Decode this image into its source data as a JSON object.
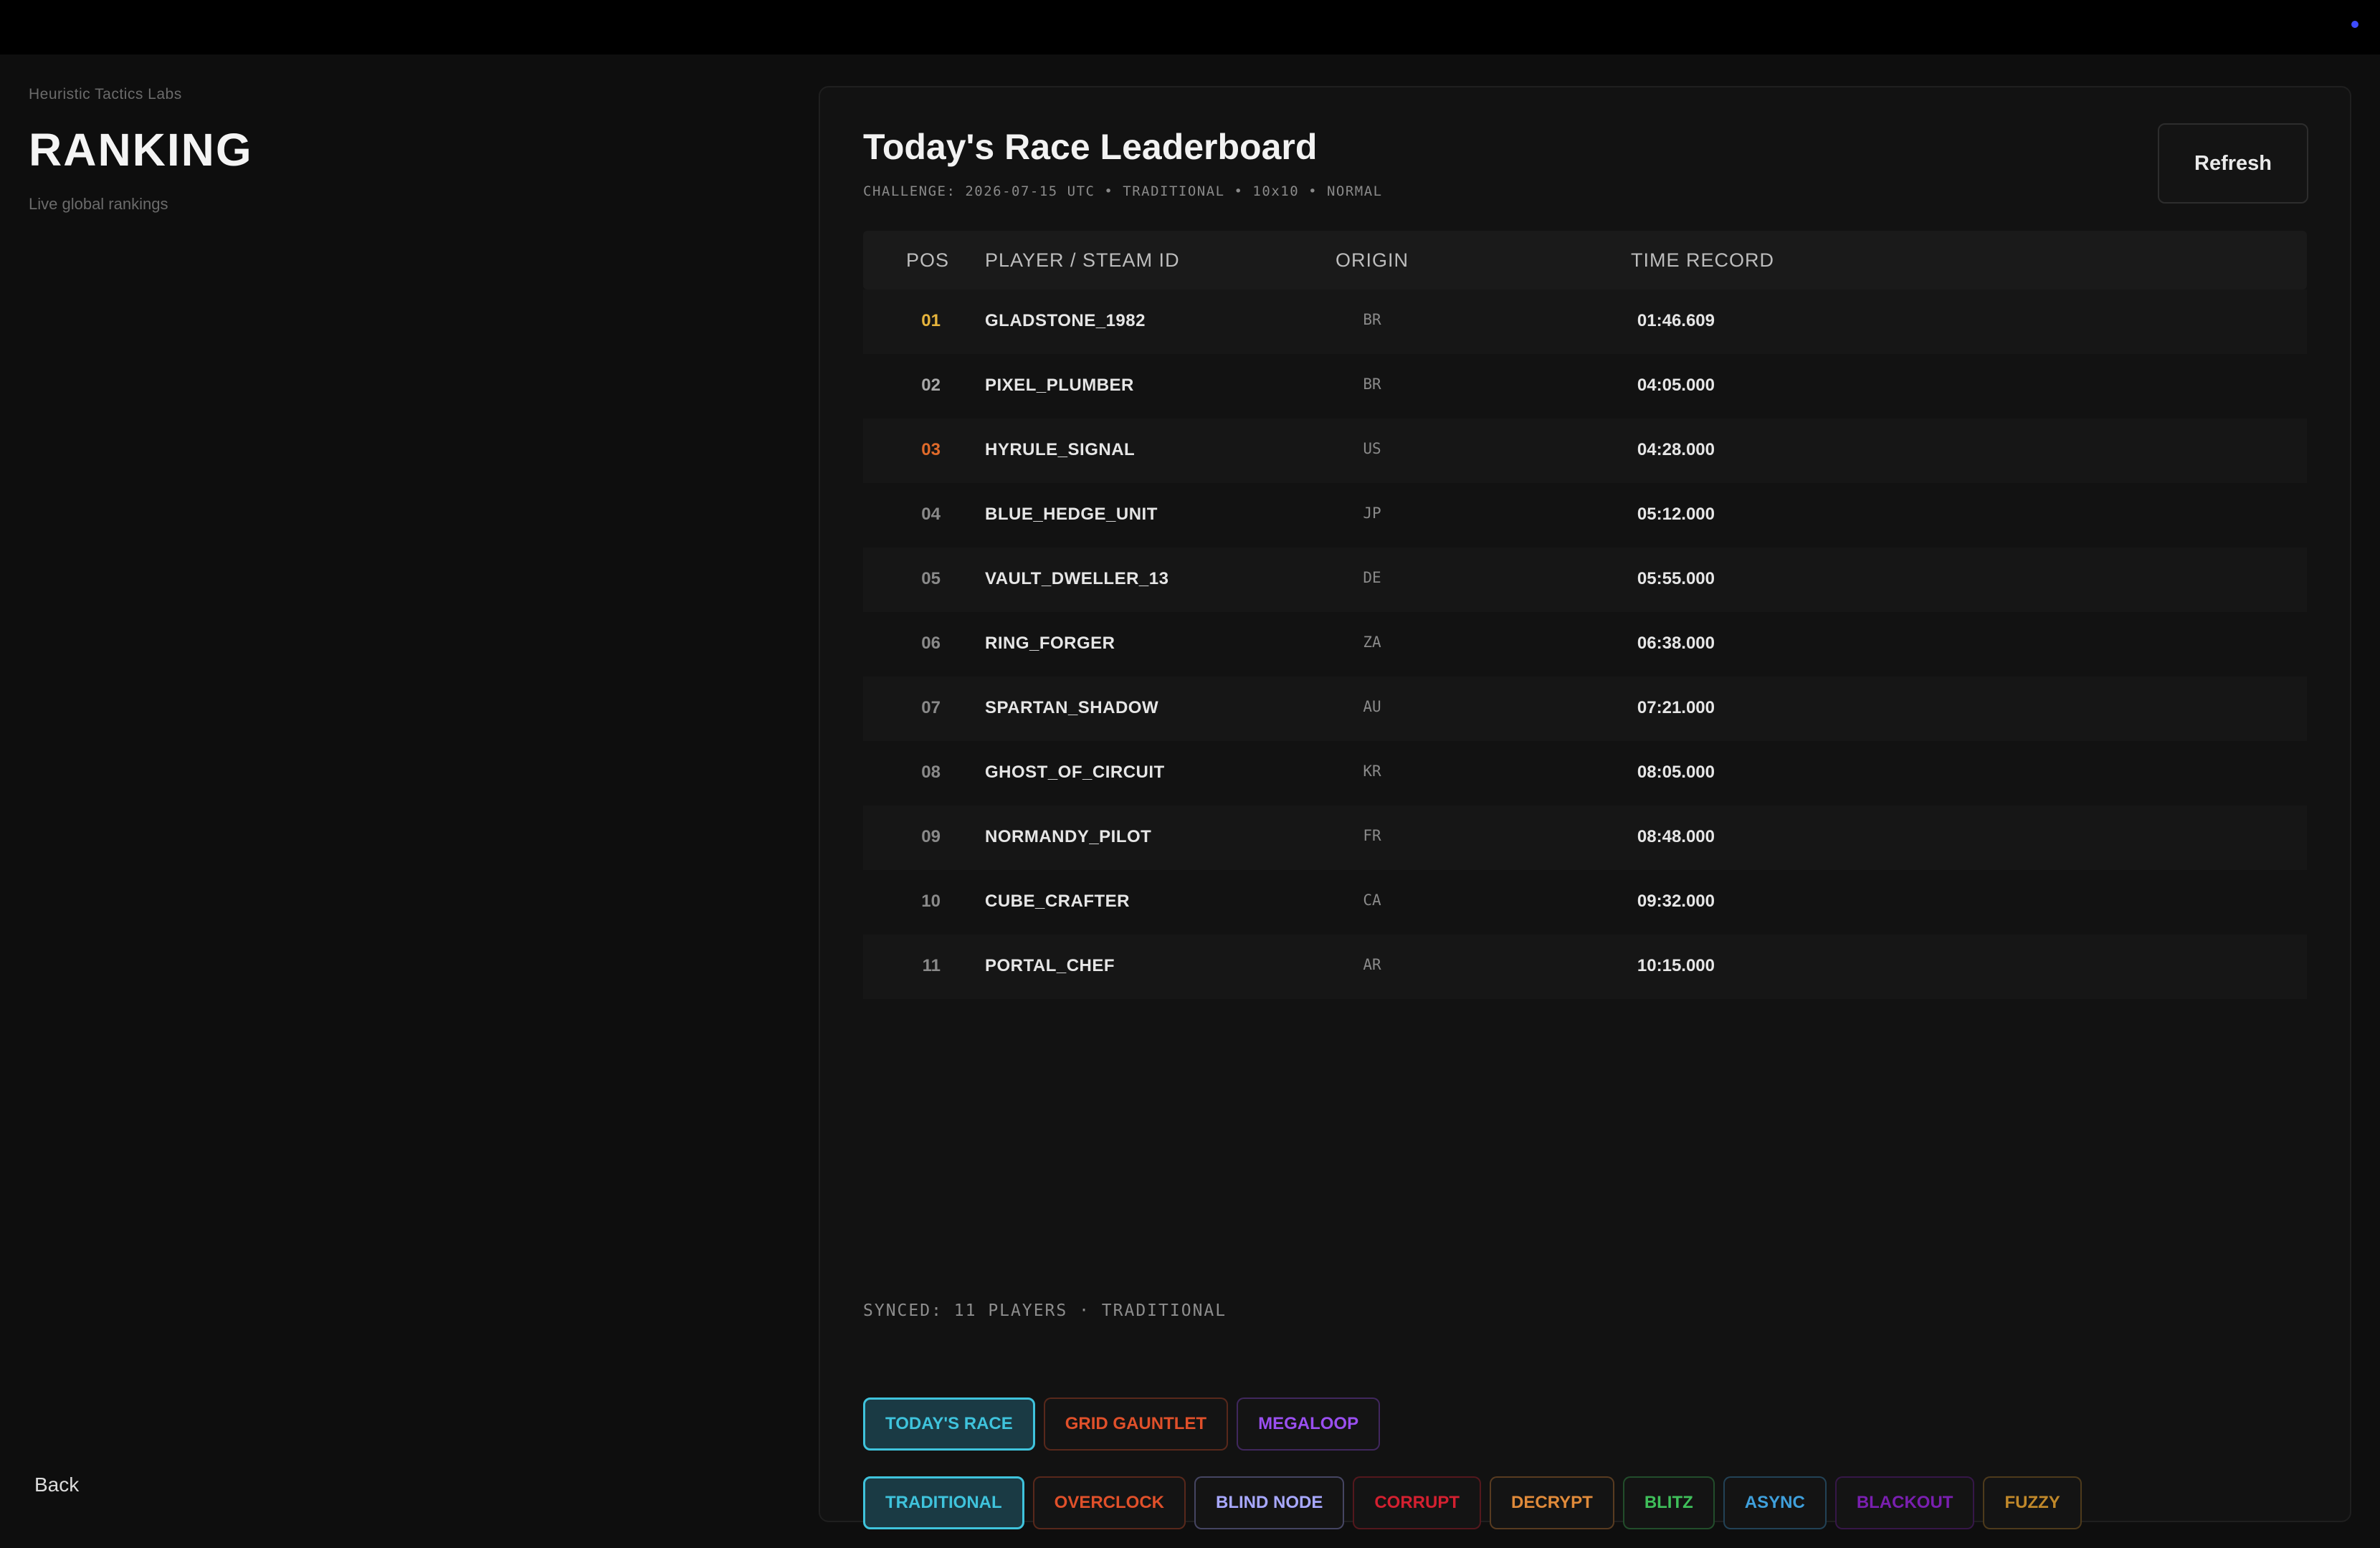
{
  "header": {
    "org": "Heuristic Tactics Labs",
    "title": "RANKING",
    "subtitle": "Live global rankings",
    "back_label": "Back"
  },
  "panel": {
    "title": "Today's Race Leaderboard",
    "meta": "CHALLENGE: 2026-07-15 UTC • TRADITIONAL • 10x10 • NORMAL",
    "refresh_label": "Refresh"
  },
  "table": {
    "columns": [
      "POS",
      "PLAYER / STEAM ID",
      "ORIGIN",
      "TIME RECORD"
    ],
    "rows": [
      {
        "pos": "01",
        "player": "GLADSTONE_1982",
        "origin": "BR",
        "time": "01:46.609",
        "pos_color": "#e6b43c"
      },
      {
        "pos": "02",
        "player": "PIXEL_PLUMBER",
        "origin": "BR",
        "time": "04:05.000",
        "pos_color": "#a8a8a8"
      },
      {
        "pos": "03",
        "player": "HYRULE_SIGNAL",
        "origin": "US",
        "time": "04:28.000",
        "pos_color": "#e06a2a"
      },
      {
        "pos": "04",
        "player": "BLUE_HEDGE_UNIT",
        "origin": "JP",
        "time": "05:12.000",
        "pos_color": "#8a8a8a"
      },
      {
        "pos": "05",
        "player": "VAULT_DWELLER_13",
        "origin": "DE",
        "time": "05:55.000",
        "pos_color": "#8a8a8a"
      },
      {
        "pos": "06",
        "player": "RING_FORGER",
        "origin": "ZA",
        "time": "06:38.000",
        "pos_color": "#8a8a8a"
      },
      {
        "pos": "07",
        "player": "SPARTAN_SHADOW",
        "origin": "AU",
        "time": "07:21.000",
        "pos_color": "#8a8a8a"
      },
      {
        "pos": "08",
        "player": "GHOST_OF_CIRCUIT",
        "origin": "KR",
        "time": "08:05.000",
        "pos_color": "#8a8a8a"
      },
      {
        "pos": "09",
        "player": "NORMANDY_PILOT",
        "origin": "FR",
        "time": "08:48.000",
        "pos_color": "#8a8a8a"
      },
      {
        "pos": "10",
        "player": "CUBE_CRAFTER",
        "origin": "CA",
        "time": "09:32.000",
        "pos_color": "#8a8a8a"
      },
      {
        "pos": "11",
        "player": "PORTAL_CHEF",
        "origin": "AR",
        "time": "10:15.000",
        "pos_color": "#8a8a8a"
      }
    ]
  },
  "status": "SYNCED: 11 PLAYERS · TRADITIONAL",
  "mode_tabs": [
    {
      "label": "TODAY'S RACE",
      "color": "#3fc3dc",
      "active": true
    },
    {
      "label": "GRID GAUNTLET",
      "color": "#e0502a",
      "active": false
    },
    {
      "label": "MEGALOOP",
      "color": "#9a4ff0",
      "active": false
    }
  ],
  "variant_tabs": [
    {
      "label": "TRADITIONAL",
      "color": "#3fc3dc",
      "active": true
    },
    {
      "label": "OVERCLOCK",
      "color": "#e0502a",
      "active": false
    },
    {
      "label": "BLIND NODE",
      "color": "#a8a8ff",
      "active": false
    },
    {
      "label": "CORRUPT",
      "color": "#d42030",
      "active": false
    },
    {
      "label": "DECRYPT",
      "color": "#e08a3a",
      "active": false
    },
    {
      "label": "BLITZ",
      "color": "#3fbf5a",
      "active": false
    },
    {
      "label": "ASYNC",
      "color": "#3fa0dc",
      "active": false
    },
    {
      "label": "BLACKOUT",
      "color": "#7a1fb0",
      "active": false
    },
    {
      "label": "FUZZY",
      "color": "#c0882a",
      "active": false
    }
  ],
  "topbar": {
    "indicator_color": "#3d4bff"
  }
}
